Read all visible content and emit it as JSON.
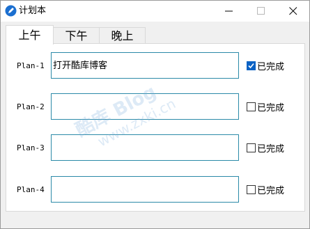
{
  "window": {
    "title": "计划本"
  },
  "tabs": [
    {
      "label": "上午"
    },
    {
      "label": "下午"
    },
    {
      "label": "晚上"
    }
  ],
  "plans": [
    {
      "label": "Plan-1",
      "value": "打开酷库博客",
      "done_label": "已完成",
      "done": true
    },
    {
      "label": "Plan-2",
      "value": "",
      "done_label": "已完成",
      "done": false
    },
    {
      "label": "Plan-3",
      "value": "",
      "done_label": "已完成",
      "done": false
    },
    {
      "label": "Plan-4",
      "value": "",
      "done_label": "已完成",
      "done": false
    }
  ],
  "watermark": {
    "main": "酷库 Blog",
    "sub": "www.zxki.cn"
  },
  "colors": {
    "accent": "#0b62c4",
    "field_border": "#2b8aa8"
  }
}
